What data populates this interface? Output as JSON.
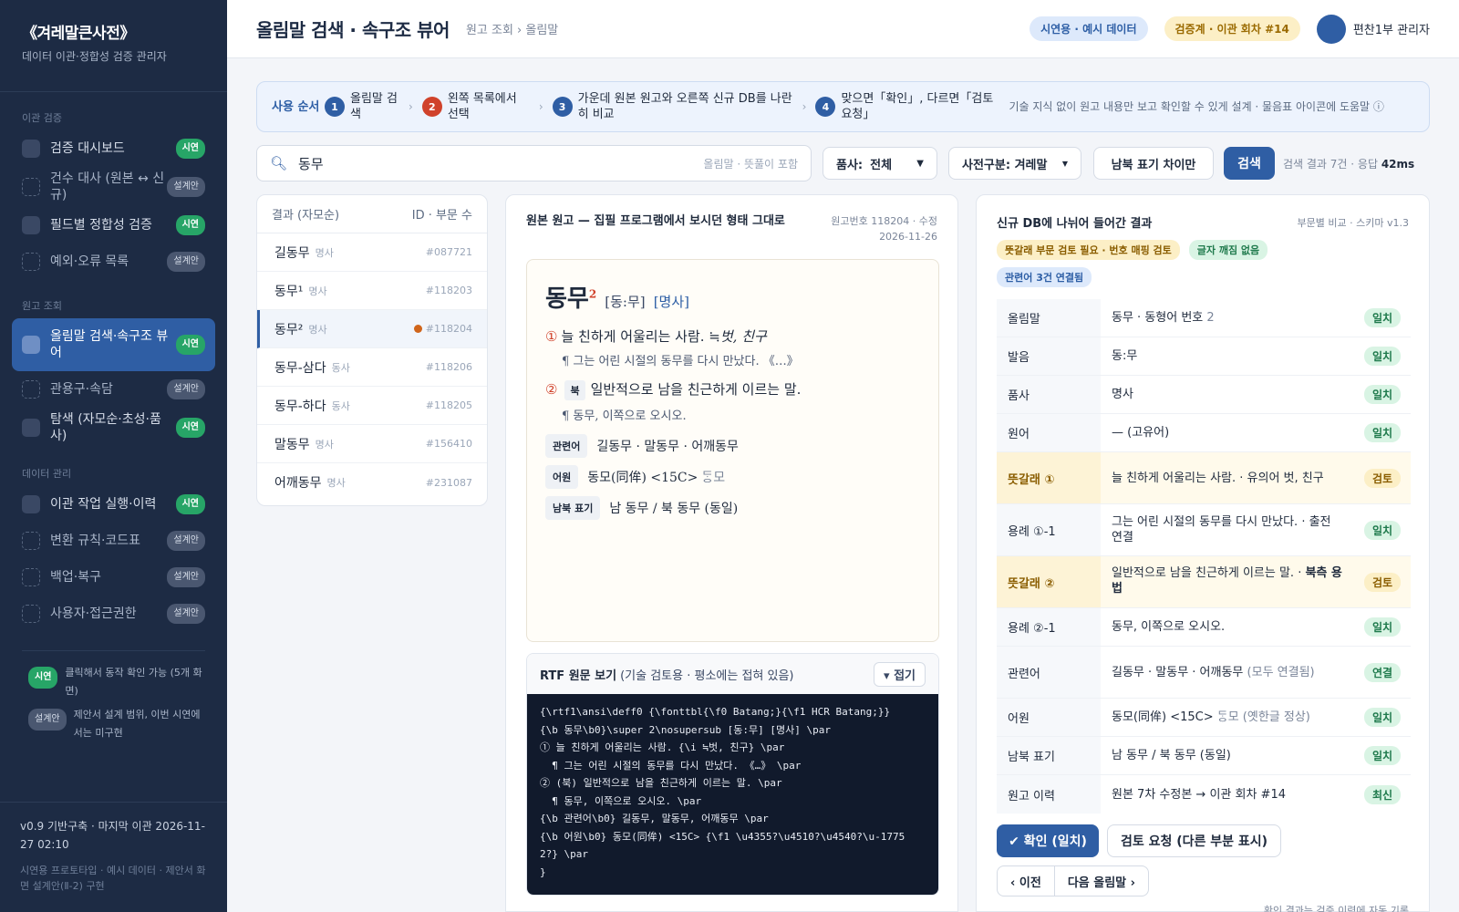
{
  "sidebar": {
    "brand_title": "《겨레말큰사전》",
    "brand_sub": "데이터 이관·정합성 검증 관리자",
    "sections": [
      {
        "title": "이관 검증",
        "items": [
          {
            "label": "검증 대시보드",
            "badge": "시연",
            "live": true
          },
          {
            "label": "건수 대사 (원본 ↔ 신규)",
            "badge": "설계안",
            "live": false
          },
          {
            "label": "필드별 정합성 검증",
            "badge": "시연",
            "live": true
          },
          {
            "label": "예외·오류 목록",
            "badge": "설계안",
            "live": false
          }
        ]
      },
      {
        "title": "원고 조회",
        "items": [
          {
            "label": "올림말 검색·속구조 뷰어",
            "badge": "시연",
            "live": true,
            "active": true
          },
          {
            "label": "관용구·속담",
            "badge": "설계안",
            "live": false
          },
          {
            "label": "탐색 (자모순·초성·품사)",
            "badge": "시연",
            "live": true
          }
        ]
      },
      {
        "title": "데이터 관리",
        "items": [
          {
            "label": "이관 작업 실행·이력",
            "badge": "시연",
            "live": true
          },
          {
            "label": "변환 규칙·코드표",
            "badge": "설계안",
            "live": false
          },
          {
            "label": "백업·복구",
            "badge": "설계안",
            "live": false
          },
          {
            "label": "사용자·접근권한",
            "badge": "설계안",
            "live": false
          }
        ]
      }
    ],
    "legend": [
      {
        "badge": "시연",
        "text": "클릭해서 동작 확인 가능 (5개 화면)"
      },
      {
        "badge": "설계안",
        "text": "제안서 설계 범위, 이번 시연에서는 미구현"
      }
    ],
    "footer_version": "v0.9 기반구축 · 마지막 이관 2026-11-27 02:10",
    "footer_note": "시연용 프로토타입 · 예시 데이터 · 제안서 화면 설계안(Ⅱ-2) 구현"
  },
  "topbar": {
    "title": "올림말 검색 · 속구조 뷰어",
    "breadcrumb": "원고 조회 › 올림말",
    "demo_pill": "시연용 · 예시 데이터",
    "round_pill": "검증계 · 이관 회차 #14",
    "user": "편찬1부 관리자"
  },
  "guide": {
    "label": "사용 순서",
    "steps": [
      {
        "num": "1",
        "text": "올림말 검색"
      },
      {
        "num": "2",
        "text": "왼쪽 목록에서 선택"
      },
      {
        "num": "3",
        "text": "가운데 원본 원고와 오른쪽 신규 DB를 나란히 비교"
      },
      {
        "num": "4",
        "text": "맞으면「확인」, 다르면「검토 요청」"
      }
    ],
    "note": "기술 지식 없이 원고 내용만 보고 확인할 수 있게 설계 · 물음표 아이콘에 도움말 ⓘ"
  },
  "search": {
    "value": "동무",
    "hint": "올림말 · 뜻풀이 포함",
    "pos_label": "품사:",
    "pos_value": "전체",
    "dict_filter": "사전구분: 겨레말",
    "nk_button": "남북 표기 차이만",
    "submit": "검색",
    "stat_prefix": "검색 결과 7건 · 응답 ",
    "stat_ms": "42ms"
  },
  "results": {
    "header_left": "결과 (자모순)",
    "header_right": "ID · 부문 수",
    "rows": [
      {
        "word": "길동무",
        "pos": "명사",
        "id": "#087721"
      },
      {
        "word": "동무¹",
        "pos": "명사",
        "id": "#118203"
      },
      {
        "word": "동무²",
        "pos": "명사",
        "id": "#118204",
        "selected": true
      },
      {
        "word": "동무-삼다",
        "pos": "동사",
        "id": "#118206"
      },
      {
        "word": "동무-하다",
        "pos": "동사",
        "id": "#118205"
      },
      {
        "word": "말동무",
        "pos": "명사",
        "id": "#156410"
      },
      {
        "word": "어깨동무",
        "pos": "명사",
        "id": "#231087"
      }
    ]
  },
  "original": {
    "title": "원본 원고 — 집필 프로그램에서 보시던 형태 그대로",
    "meta_line1": "원고번호 118204 · 수정",
    "meta_line2": "2026-11-26",
    "headword": "동무",
    "homonym": "2",
    "pron": "[동:무]",
    "pos": "[명사]",
    "sense1_num": "①",
    "sense1_text": "늘 친하게 어울리는 사람. ",
    "sense1_syn": "≒벗, 친구",
    "ex1": "¶ 그는 어린 시절의 동무를 다시 만났다. 《…》",
    "sense2_num": "②",
    "sense2_tag": "북",
    "sense2_text": "일반적으로 남을 친근하게 이르는 말.",
    "ex2": "¶ 동무, 이쪽으로 오시오.",
    "related_label": "관련어",
    "related": "길동무 · 말동무 · 어깨동무",
    "etym_label": "어원",
    "etym": "동모(同侔) <15C> ",
    "etym_old": "ᄃᆞᆼ모",
    "nk_label": "남북 표기",
    "nk": "남 동무 / 북 동무 (동일)",
    "rtf_title": "RTF 원문 보기",
    "rtf_sub": "(기술 검토용 · 평소에는 접혀 있음)",
    "rtf_fold": "▾ 접기",
    "rtf_lines": [
      "{\\rtf1\\ansi\\deff0 {\\fonttbl{\\f0 Batang;}{\\f1 HCR Batang;}}",
      "{\\b 동무\\b0}\\super 2\\nosupersub [동:무] [명사] \\par",
      "① 늘 친하게 어울리는 사람. {\\i ≒벗, 친구} \\par",
      "  ¶ 그는 어린 시절의 동무를 다시 만났다. 《…》 \\par",
      "② (북) 일반적으로 남을 친근하게 이르는 말. \\par",
      "  ¶ 동무, 이쪽으로 오시오. \\par",
      "{\\b 관련어\\b0} 길동무, 말동무, 어깨동무 \\par",
      "{\\b 어원\\b0} 동모(同侔) <15C> {\\f1 \\u4355?\\u4510?\\u4540?\\u-1775",
      "2?} \\par",
      "}"
    ]
  },
  "db": {
    "title": "신규 DB에 나뉘어 들어간 결과",
    "meta": "부문별 비교 · 스키마 v1.3",
    "tag_amber": "뜻갈래 부문 검토 필요 · 번호 매핑 검토",
    "tag_green": "글자 깨짐 없음",
    "tag_blue": "관련어 3건 연결됨",
    "rows": [
      {
        "field": "올림말",
        "value": "동무 · 동형어 번호 ",
        "value_gray": "2",
        "status": "일치"
      },
      {
        "field": "발음",
        "value": "동:무",
        "status": "일치"
      },
      {
        "field": "품사",
        "value": "명사",
        "status": "일치"
      },
      {
        "field": "원어",
        "value": "— (고유어)",
        "status": "일치"
      },
      {
        "field": "뜻갈래 ①",
        "value": "늘 친하게 어울리는 사람. · 유의어 벗, 친구",
        "status": "검토",
        "warn": true
      },
      {
        "field": "용례 ①-1",
        "value": "그는 어린 시절의 동무를 다시 만났다. · 출전 연결",
        "status": "일치"
      },
      {
        "field": "뜻갈래 ②",
        "value": "일반적으로 남을 친근하게 이르는 말. · ",
        "value_bold": "북측 용법",
        "status": "검토",
        "warn": true
      },
      {
        "field": "용례 ②-1",
        "value": "동무, 이쪽으로 오시오.",
        "status": "일치"
      },
      {
        "field": "관련어",
        "value": "길동무 · 말동무 · 어깨동무 ",
        "value_gray": "(모두 연결됨)",
        "status": "연결"
      },
      {
        "field": "어원",
        "value": "동모(同侔) <15C> ",
        "value_gray": "ᄃᆞᆼ모 (옛한글 정상)",
        "status": "일치"
      },
      {
        "field": "남북 표기",
        "value": "남 동무 / 북 동무 (동일)",
        "status": "일치"
      },
      {
        "field": "원고 이력",
        "value": "원본 7차 수정본 → 이관 회차 #14",
        "status": "최신"
      }
    ],
    "confirm": "✔ 확인 (일치)",
    "review": "검토 요청 (다른 부분 표시)",
    "prev": "‹ 이전",
    "next": "다음 올림말 ›",
    "note": "확인 결과는 검증 이력에 자동 기록"
  }
}
